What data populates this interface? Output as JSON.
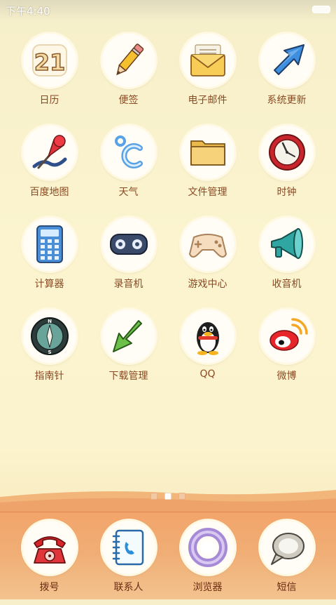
{
  "status_bar": {
    "time": "下午4:40"
  },
  "apps": [
    {
      "id": "calendar",
      "label": "日历",
      "icon": "calendar-icon",
      "icon_text": "21"
    },
    {
      "id": "notes",
      "label": "便签",
      "icon": "pencil-icon"
    },
    {
      "id": "email",
      "label": "电子邮件",
      "icon": "envelope-icon"
    },
    {
      "id": "update",
      "label": "系统更新",
      "icon": "arrow-up-right-icon"
    },
    {
      "id": "maps",
      "label": "百度地图",
      "icon": "pushpin-icon"
    },
    {
      "id": "weather",
      "label": "天气",
      "icon": "celsius-icon"
    },
    {
      "id": "files",
      "label": "文件管理",
      "icon": "folder-icon"
    },
    {
      "id": "clock",
      "label": "时钟",
      "icon": "clock-icon"
    },
    {
      "id": "calculator",
      "label": "计算器",
      "icon": "calculator-icon"
    },
    {
      "id": "recorder",
      "label": "录音机",
      "icon": "cassette-icon"
    },
    {
      "id": "games",
      "label": "游戏中心",
      "icon": "gamepad-icon"
    },
    {
      "id": "radio",
      "label": "收音机",
      "icon": "megaphone-icon"
    },
    {
      "id": "compass",
      "label": "指南针",
      "icon": "compass-icon",
      "icon_text_n": "N",
      "icon_text_s": "S"
    },
    {
      "id": "downloads",
      "label": "下载管理",
      "icon": "arrow-down-left-icon"
    },
    {
      "id": "qq",
      "label": "QQ",
      "icon": "penguin-icon"
    },
    {
      "id": "weibo",
      "label": "微博",
      "icon": "weibo-icon"
    }
  ],
  "page_indicator": {
    "pages": 3,
    "current": 2
  },
  "dock": [
    {
      "id": "dialer",
      "label": "拨号",
      "icon": "telephone-icon"
    },
    {
      "id": "contacts",
      "label": "联系人",
      "icon": "contacts-book-icon"
    },
    {
      "id": "browser",
      "label": "浏览器",
      "icon": "browser-ring-icon"
    },
    {
      "id": "messages",
      "label": "短信",
      "icon": "speech-bubble-icon"
    }
  ],
  "colors": {
    "label": "#8a4a24",
    "dock": "#f2a56b",
    "background": "#fbf4cf"
  }
}
